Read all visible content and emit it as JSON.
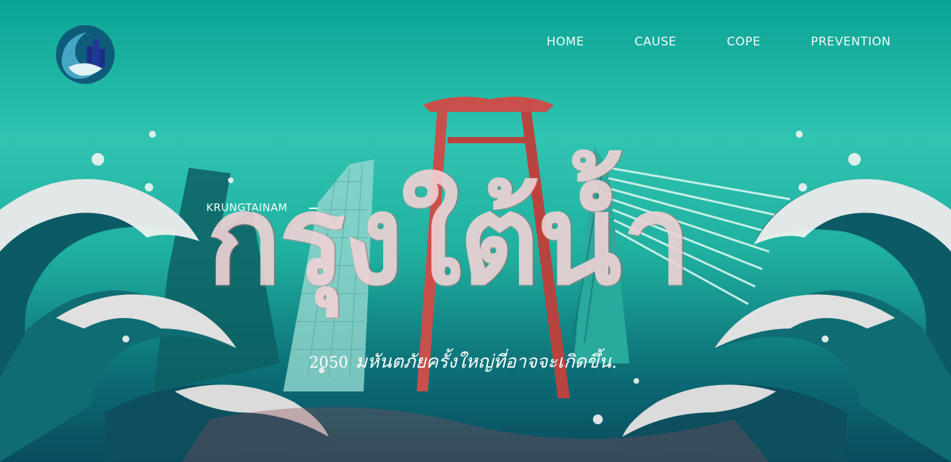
{
  "nav": {
    "items": [
      {
        "label": "HOME"
      },
      {
        "label": "CAUSE"
      },
      {
        "label": "COPE"
      },
      {
        "label": "PREVENTION"
      }
    ]
  },
  "hero": {
    "kicker": "KRUNGTAINAM",
    "title": "กรุงใต้น้ำ",
    "year": "2050",
    "subtitle": "มหันตภัยครั้งใหญ่ที่อาจจะเกิดขึ้น."
  },
  "colors": {
    "sea_top": "#0aa394",
    "sea_mid": "#30c4b1",
    "deep": "#0a4a5e",
    "swing_red": "#c9504a",
    "wave_foam": "#f1eae8",
    "title_pink": "#f1d2d5"
  },
  "icons": {
    "logo": "wave-city-logo"
  }
}
